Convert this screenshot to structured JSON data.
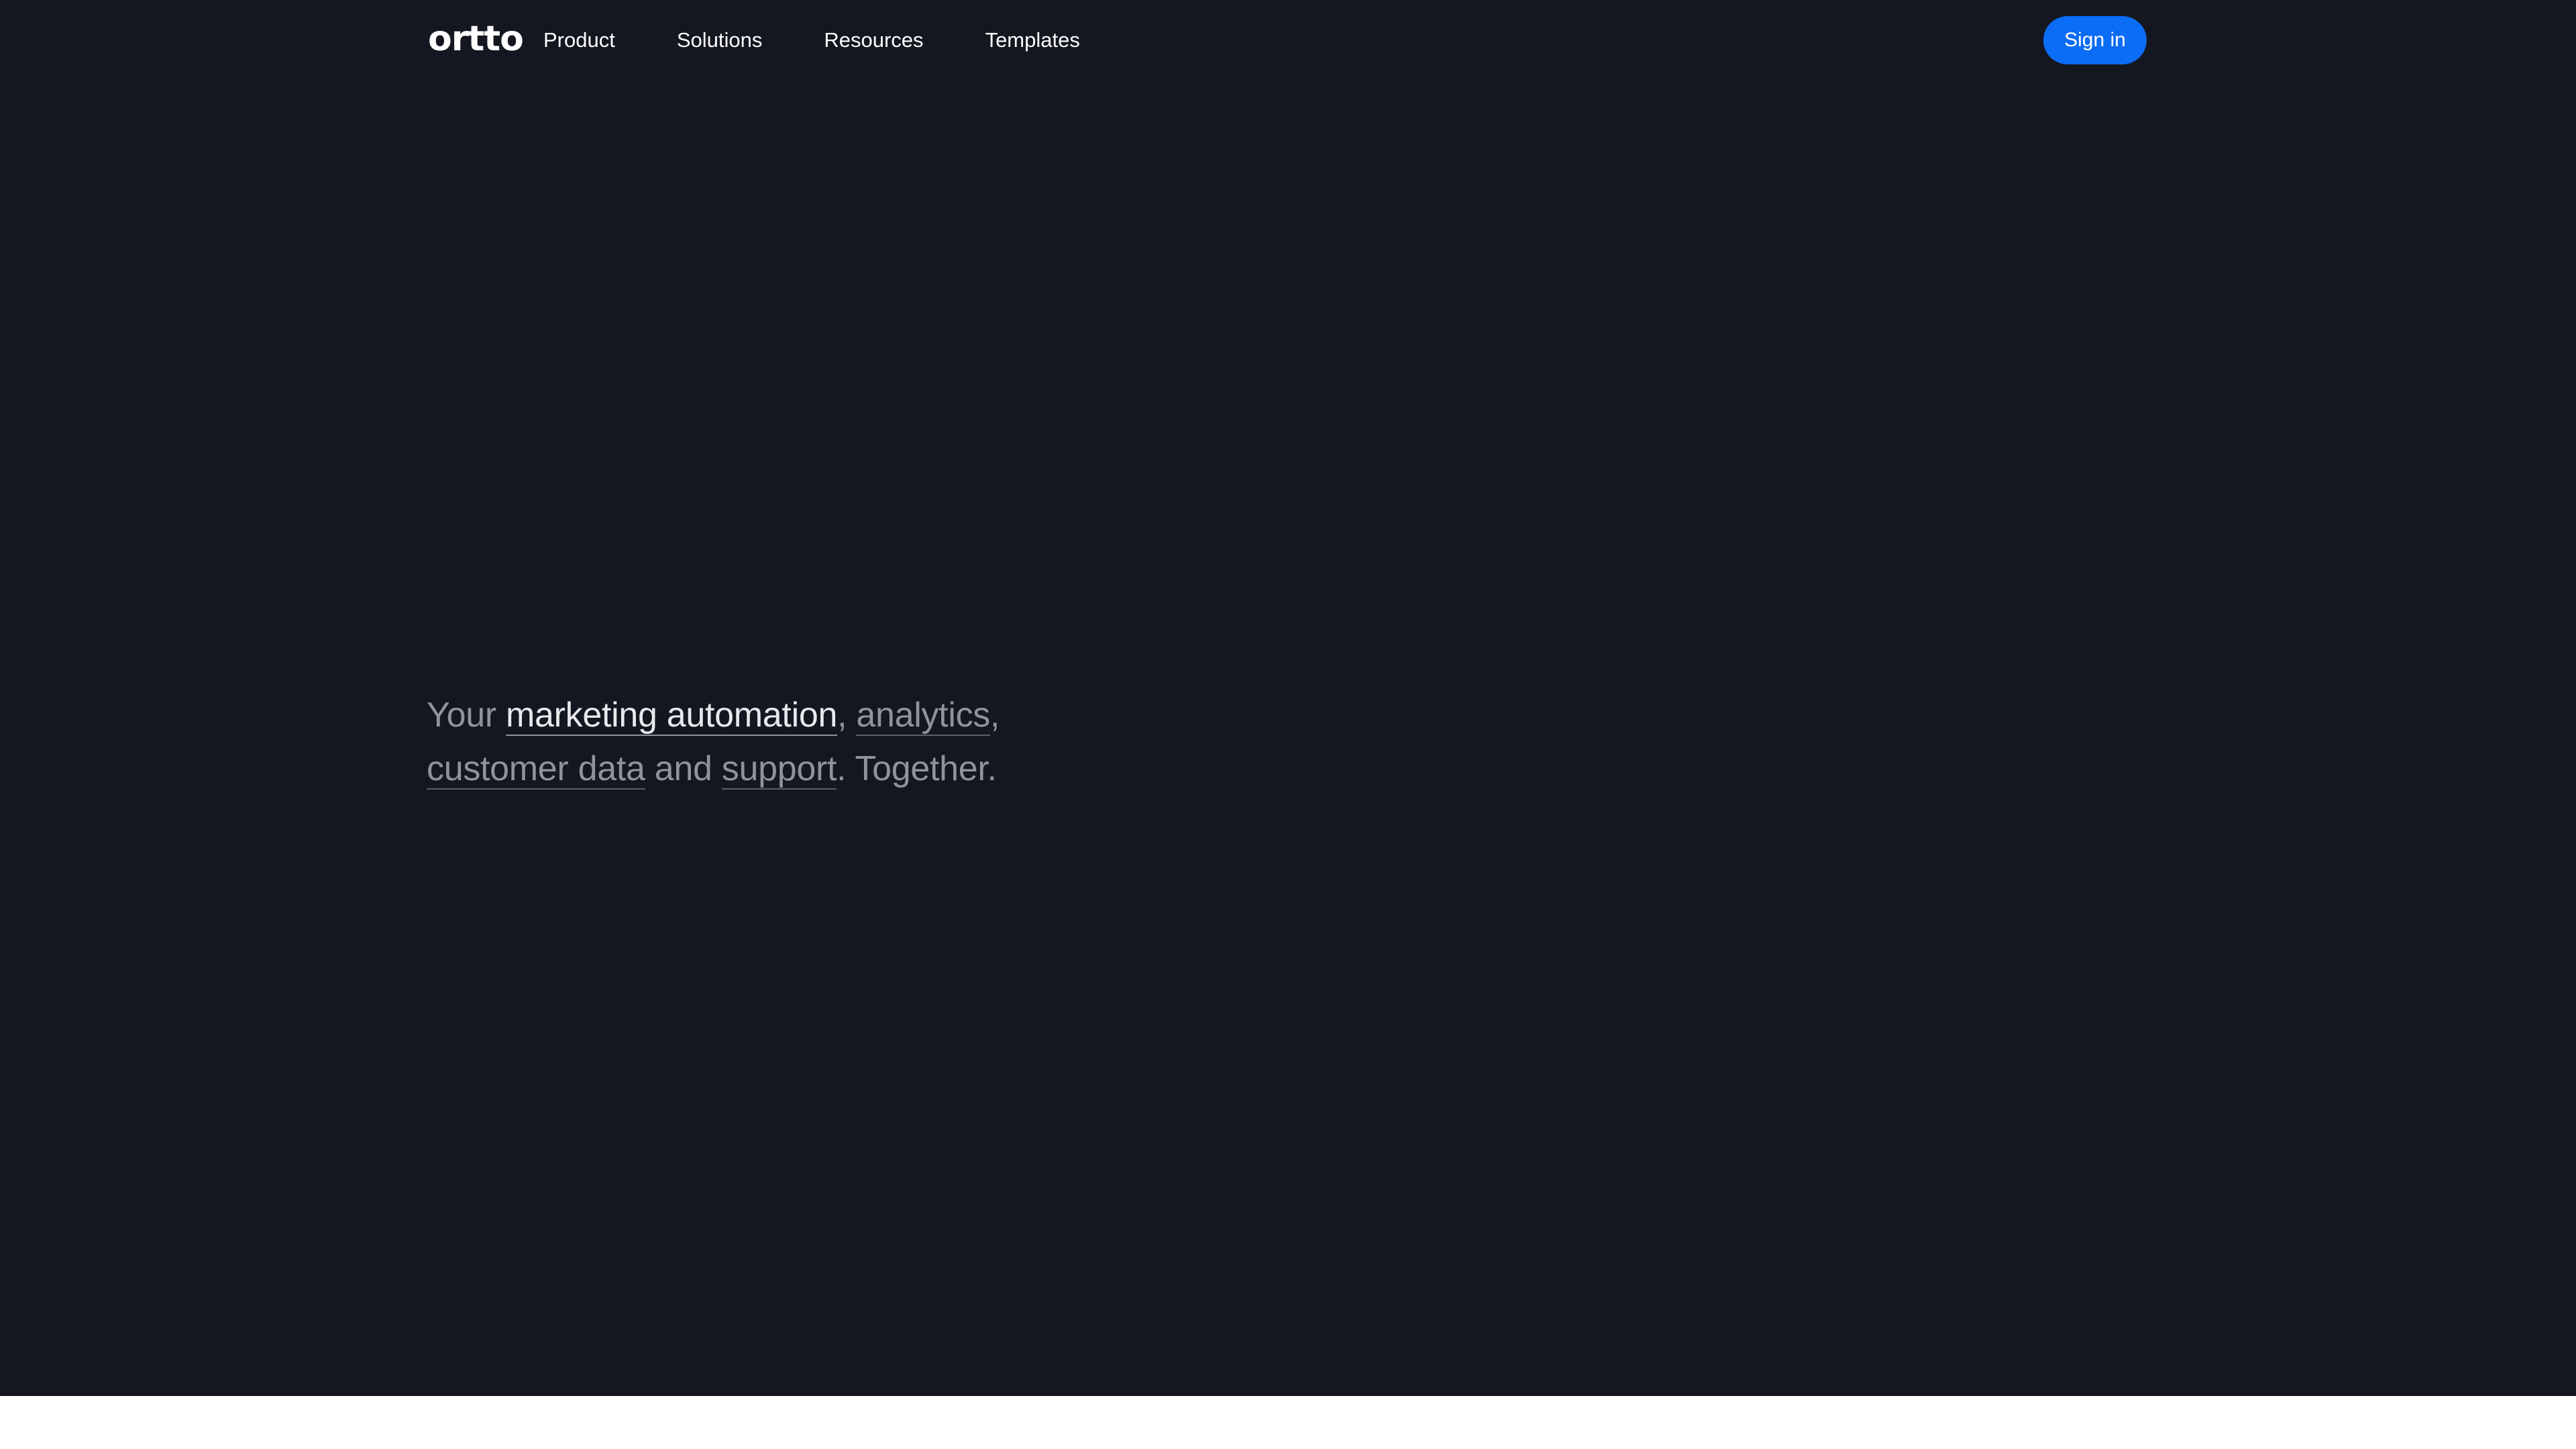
{
  "nav": {
    "logo": "ortto",
    "links": [
      "Product",
      "Solutions",
      "Resources",
      "Templates"
    ],
    "signin_label": "Sign in"
  },
  "hero": {
    "prefix": "Your ",
    "term1": "marketing automation",
    "sep1": ", ",
    "term2": "analytics",
    "sep2": ", ",
    "term3": "customer data",
    "sep3": " and ",
    "term4": "support",
    "suffix": ". Together."
  },
  "colors": {
    "background": "#141720",
    "accent": "#0b6cf5",
    "footer": "#ffffff"
  }
}
